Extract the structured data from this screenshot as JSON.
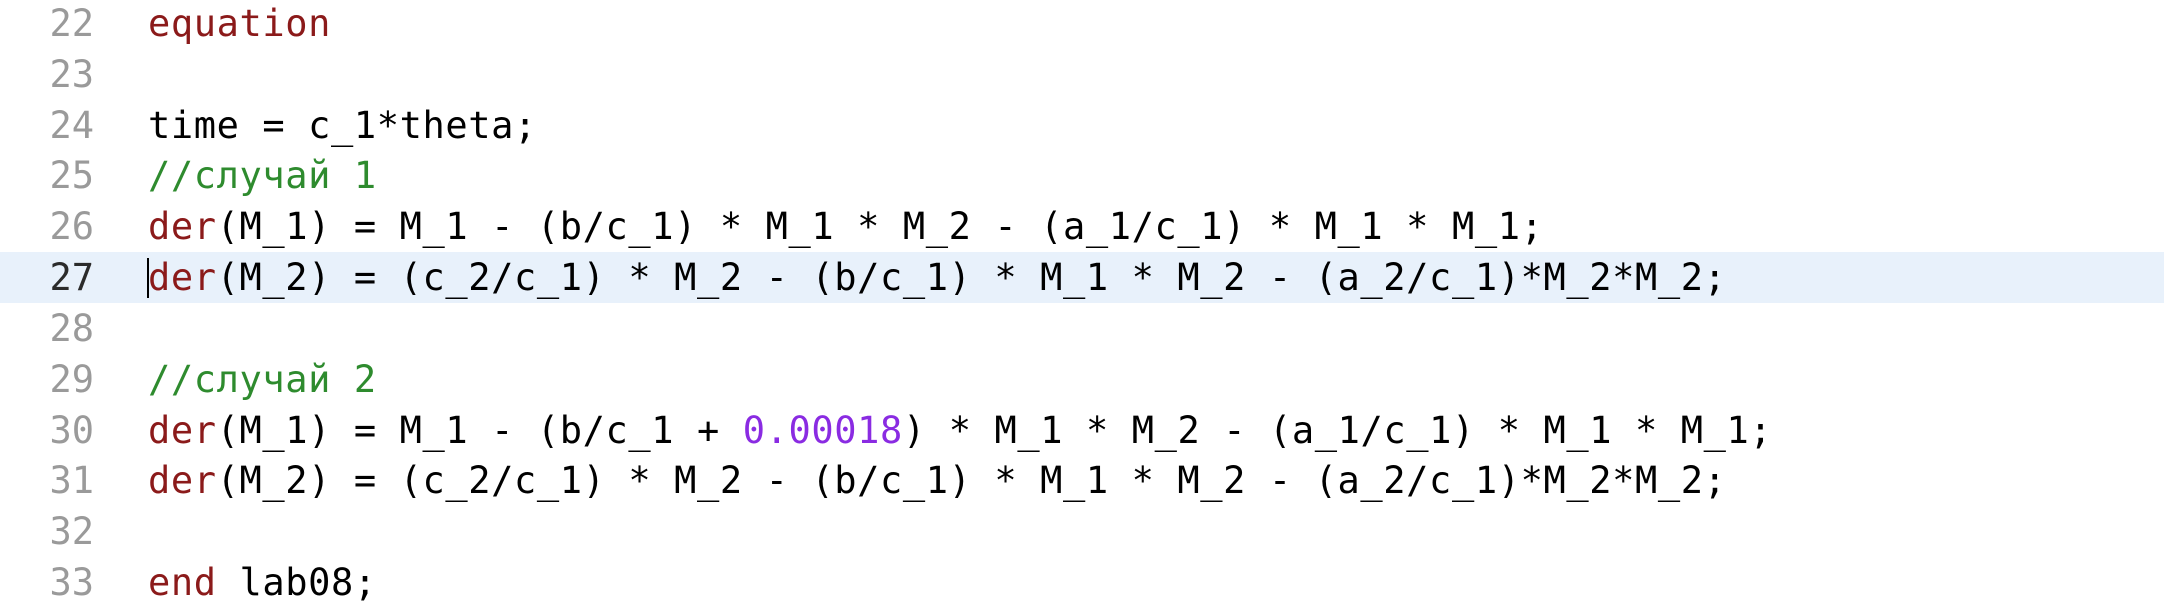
{
  "colors": {
    "keyword": "#8b1a1a",
    "comment": "#2e8b2e",
    "number": "#8a2be2",
    "line_number": "#9a9a9a",
    "current_line_bg": "#e8f1fb"
  },
  "lines": [
    {
      "number": "22",
      "segments": [
        {
          "t": "equation",
          "c": "kw"
        }
      ]
    },
    {
      "number": "23",
      "segments": []
    },
    {
      "number": "24",
      "segments": [
        {
          "t": "time = c_1*theta;",
          "c": ""
        }
      ]
    },
    {
      "number": "25",
      "segments": [
        {
          "t": "//случай 1",
          "c": "cm"
        }
      ]
    },
    {
      "number": "26",
      "segments": [
        {
          "t": "der",
          "c": "fn"
        },
        {
          "t": "(M_1) = M_1 - (b/c_1) * M_1 * M_2 - (a_1/c_1) * M_1 * M_1;",
          "c": ""
        }
      ]
    },
    {
      "number": "27",
      "current": true,
      "segments": [
        {
          "t": "der",
          "c": "fn"
        },
        {
          "t": "(M_2) = (c_2/c_1) * M_2 - (b/c_1) * M_1 * M_2 - (a_2/c_1)*M_2*M_2;",
          "c": ""
        }
      ]
    },
    {
      "number": "28",
      "segments": []
    },
    {
      "number": "29",
      "segments": [
        {
          "t": "//случай 2",
          "c": "cm"
        }
      ]
    },
    {
      "number": "30",
      "segments": [
        {
          "t": "der",
          "c": "fn"
        },
        {
          "t": "(M_1) = M_1 - (b/c_1 + ",
          "c": ""
        },
        {
          "t": "0.00018",
          "c": "num"
        },
        {
          "t": ") * M_1 * M_2 - (a_1/c_1) * M_1 * M_1;",
          "c": ""
        }
      ]
    },
    {
      "number": "31",
      "segments": [
        {
          "t": "der",
          "c": "fn"
        },
        {
          "t": "(M_2) = (c_2/c_1) * M_2 - (b/c_1) * M_1 * M_2 - (a_2/c_1)*M_2*M_2;",
          "c": ""
        }
      ]
    },
    {
      "number": "32",
      "segments": []
    },
    {
      "number": "33",
      "segments": [
        {
          "t": "end",
          "c": "kw"
        },
        {
          "t": " lab08;",
          "c": ""
        }
      ]
    }
  ]
}
